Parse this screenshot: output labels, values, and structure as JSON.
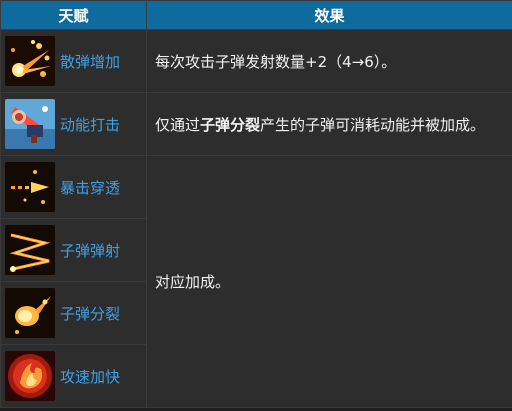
{
  "table": {
    "header": {
      "talent": "天赋",
      "effect": "效果"
    },
    "rows": [
      {
        "name": "散弹增加",
        "icon": "shotgun-burst-icon"
      },
      {
        "name": "动能打击",
        "icon": "kinetic-strike-icon"
      },
      {
        "name": "暴击穿透",
        "icon": "crit-pierce-icon"
      },
      {
        "name": "子弹弹射",
        "icon": "bullet-ricochet-icon"
      },
      {
        "name": "子弹分裂",
        "icon": "bullet-split-icon"
      },
      {
        "name": "攻速加快",
        "icon": "attack-speed-icon"
      }
    ],
    "effects": {
      "scatter": "每次攻击子弹发射数量+2（4→6）。",
      "kinetic_pre": "仅通过",
      "kinetic_bold": "子弹分裂",
      "kinetic_post": "产生的子弹可消耗动能并被加成。",
      "shared": "对应加成。"
    }
  }
}
